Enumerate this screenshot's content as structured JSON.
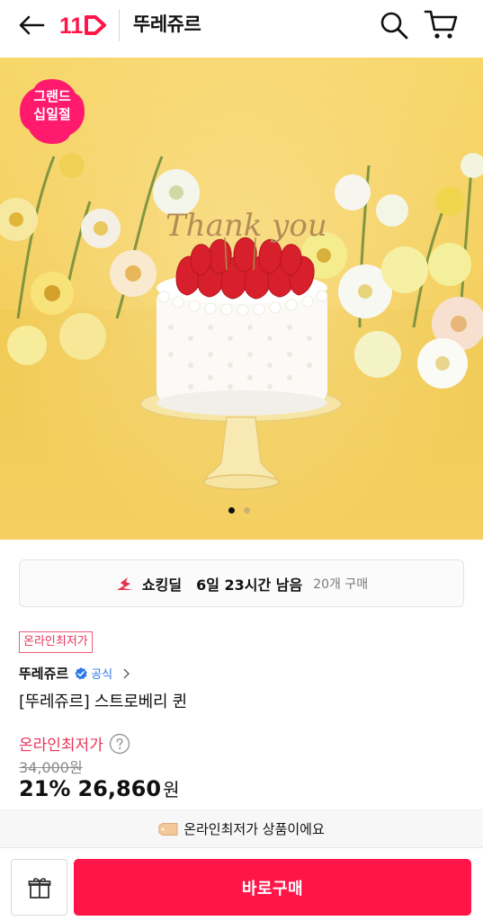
{
  "header": {
    "logo_text": "11",
    "store_title": "뚜레쥬르",
    "icons": [
      "back-arrow-icon",
      "search-icon",
      "cart-icon"
    ]
  },
  "hero": {
    "badge_line1": "그랜드",
    "badge_line2": "십일절",
    "cake_topper_text": "Thank you",
    "page_count": 2,
    "active_page": 1
  },
  "deal": {
    "label": "쇼킹딜",
    "time_left": "6일 23시간 남음",
    "purchase_count": "20개 구매"
  },
  "product": {
    "lowest_tag": "온라인최저가",
    "seller": "뚜레쥬르",
    "official_label": "공식",
    "name": "[뚜레쥬르] 스트로베리 퀸",
    "price_label": "온라인최저가",
    "original_price": "34,000원",
    "discount": "21%",
    "price": "26,860",
    "currency": "원"
  },
  "notice": {
    "text": "온라인최저가 상품이에요"
  },
  "bottom_bar": {
    "buy_label": "바로구매"
  },
  "colors": {
    "brand": "#ff1547",
    "accent_pink": "#e8355a",
    "official_blue": "#2a78e8",
    "hero_bg": "#f6d25a"
  }
}
